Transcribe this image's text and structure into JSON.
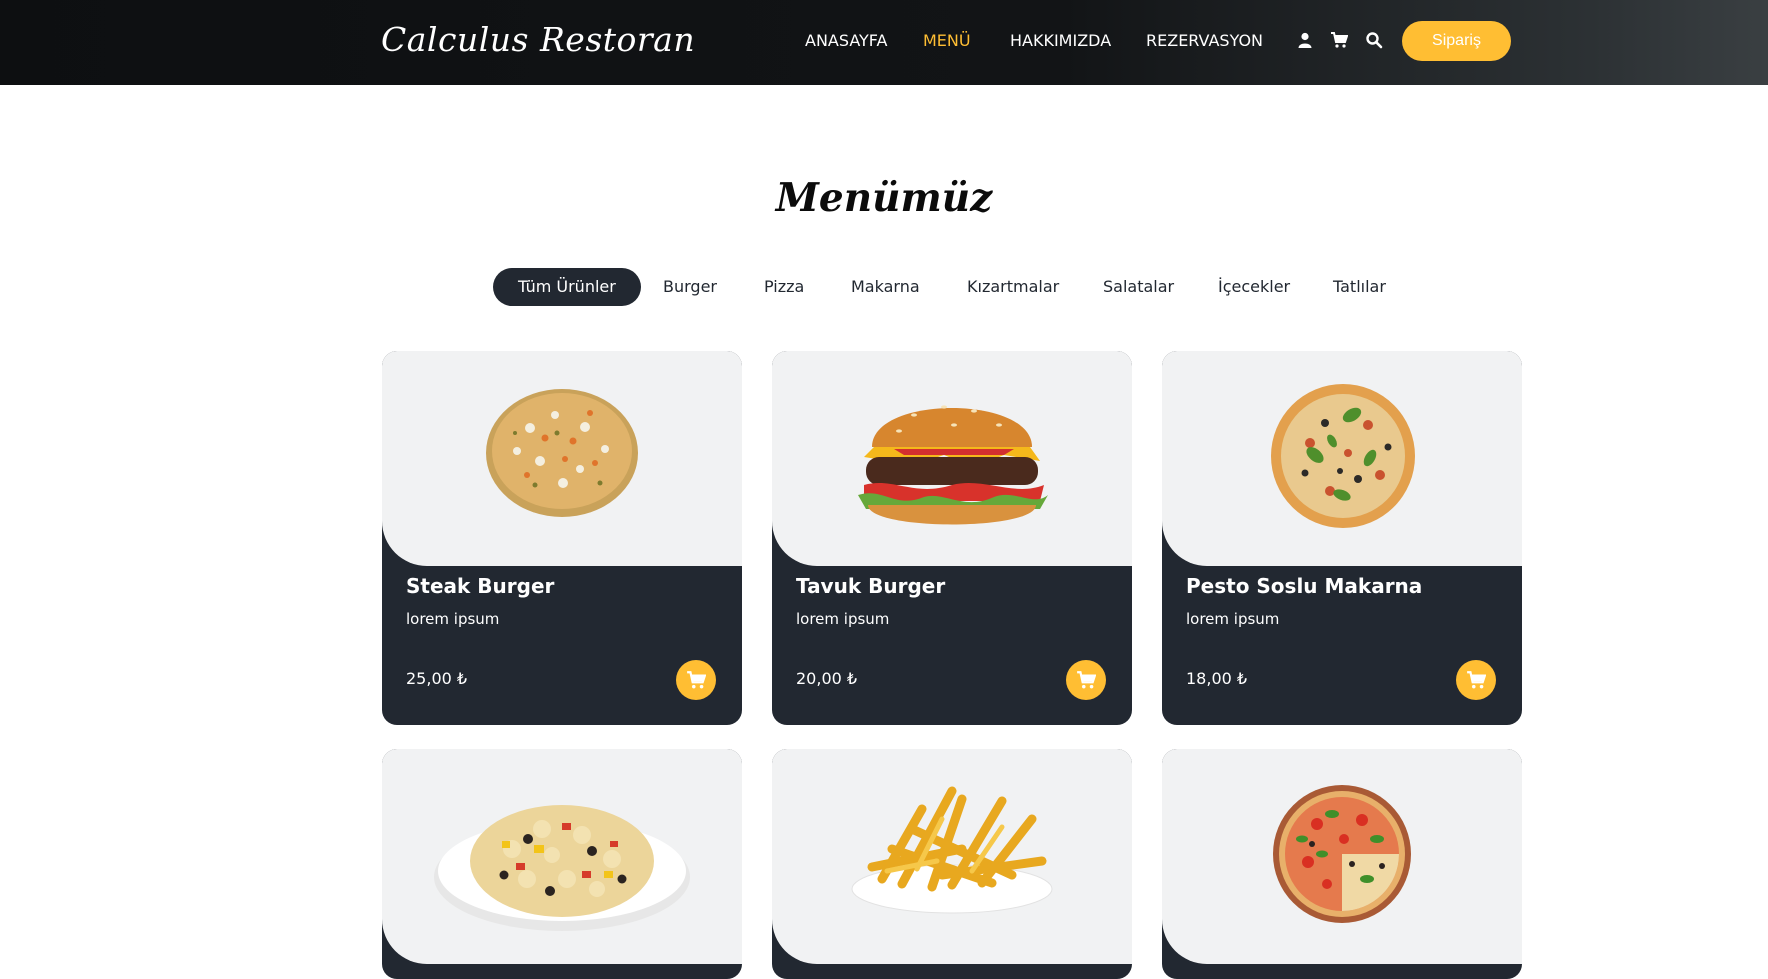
{
  "brand": {
    "logo_text": "Calculus Restoran"
  },
  "nav": {
    "items": [
      {
        "label": "ANASAYFA"
      },
      {
        "label": "MENÜ"
      },
      {
        "label": "HAKKIMIZDA"
      },
      {
        "label": "REZERVASYON"
      }
    ],
    "active_index": 1,
    "icons": [
      "user-icon",
      "cart-icon",
      "search-icon"
    ],
    "order_button": "Sipariş"
  },
  "menu": {
    "title": "Menümüz",
    "filters": [
      {
        "label": "Tüm Ürünler"
      },
      {
        "label": "Burger"
      },
      {
        "label": "Pizza"
      },
      {
        "label": "Makarna"
      },
      {
        "label": "Kızartmalar"
      },
      {
        "label": "Salatalar"
      },
      {
        "label": "İçecekler"
      },
      {
        "label": "Tatlılar"
      }
    ],
    "active_filter_index": 0,
    "products": [
      {
        "name": "Steak Burger",
        "desc": "lorem ipsum",
        "price": "25,00 ₺",
        "image": "veggie-pizza"
      },
      {
        "name": "Tavuk Burger",
        "desc": "lorem ipsum",
        "price": "20,00 ₺",
        "image": "burger"
      },
      {
        "name": "Pesto Soslu Makarna",
        "desc": "lorem ipsum",
        "price": "18,00 ₺",
        "image": "basil-pizza"
      },
      {
        "image": "pasta-salad"
      },
      {
        "image": "french-fries"
      },
      {
        "image": "margherita-pizza"
      }
    ]
  },
  "colors": {
    "accent": "#ffbe33",
    "dark": "#222831",
    "card_bg": "#f1f2f3",
    "header_bg": "#0d0f11"
  }
}
